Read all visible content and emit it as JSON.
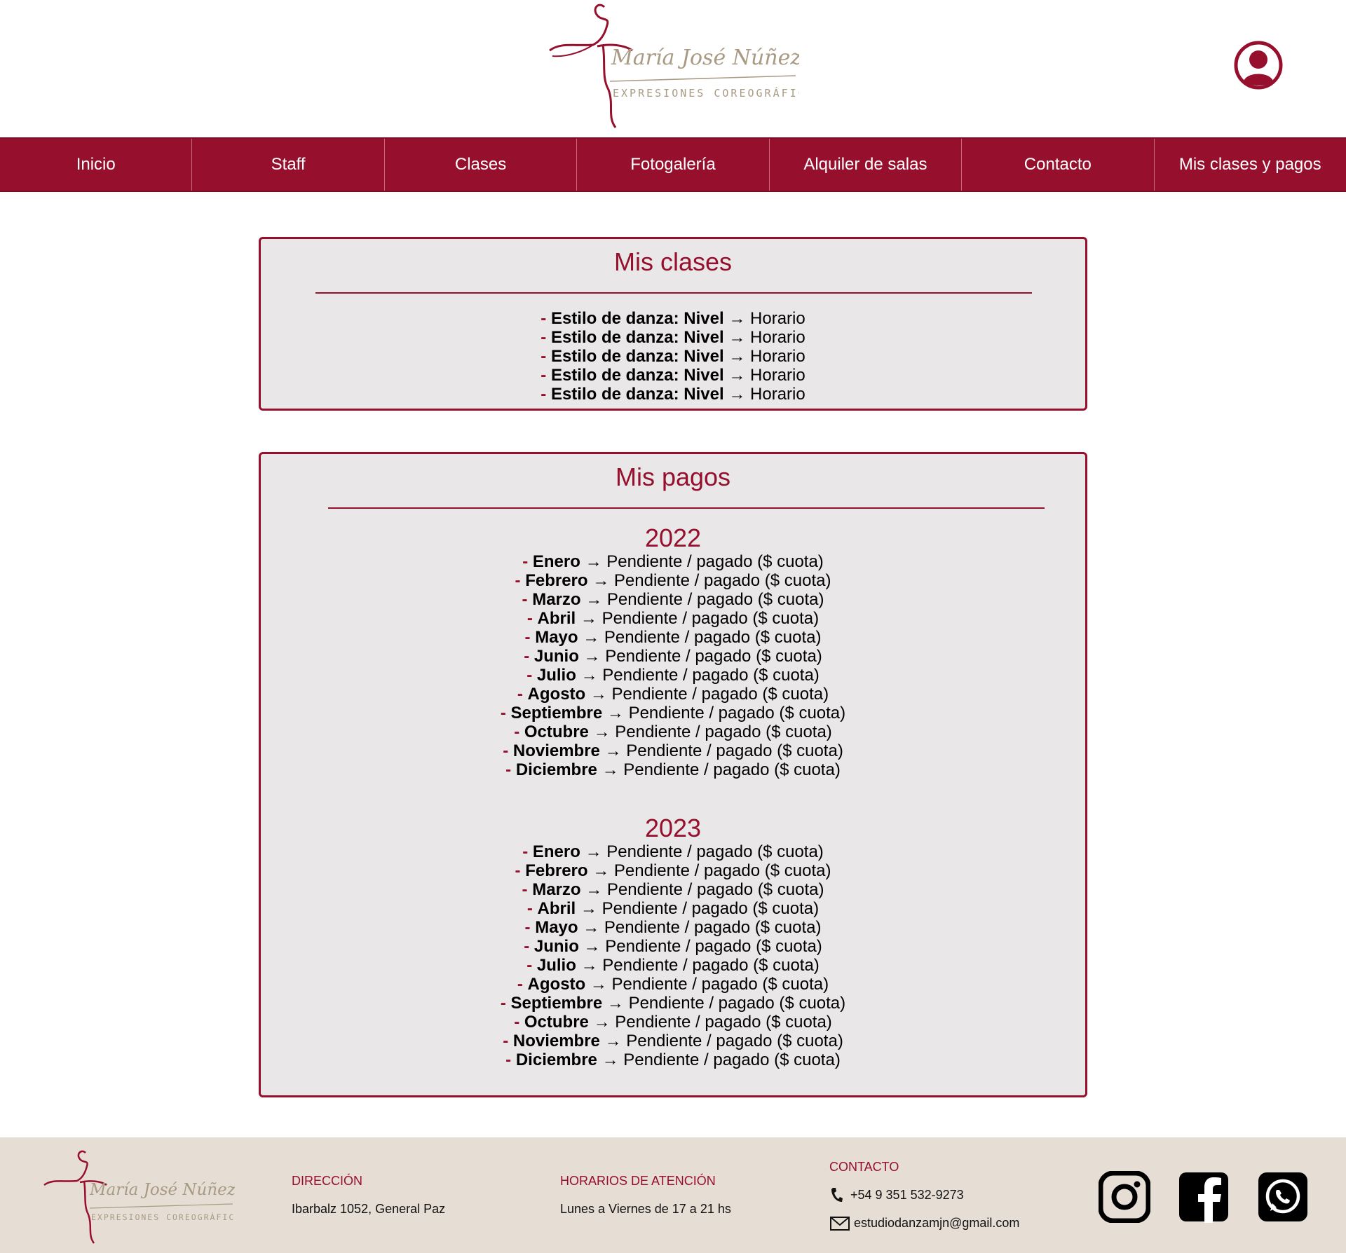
{
  "header": {
    "logo": {
      "name": "María José Núñez",
      "tagline": "EXPRESIONES COREOGRÁFICAS"
    },
    "account_icon": "user-circle-icon"
  },
  "nav": {
    "items": [
      "Inicio",
      "Staff",
      "Clases",
      "Fotogalería",
      "Alquiler de salas",
      "Contacto",
      "Mis clases y pagos"
    ]
  },
  "classes": {
    "title": "Mis clases",
    "items": [
      {
        "dash": "-",
        "label": "Estilo de danza: Nivel",
        "arrow": "→",
        "value": "Horario"
      },
      {
        "dash": "-",
        "label": "Estilo de danza: Nivel",
        "arrow": "→",
        "value": "Horario"
      },
      {
        "dash": "-",
        "label": "Estilo de danza: Nivel",
        "arrow": "→",
        "value": "Horario"
      },
      {
        "dash": "-",
        "label": "Estilo de danza: Nivel",
        "arrow": "→",
        "value": "Horario"
      },
      {
        "dash": "-",
        "label": "Estilo de danza: Nivel",
        "arrow": "→",
        "value": "Horario"
      }
    ]
  },
  "payments": {
    "title": "Mis pagos",
    "years": [
      {
        "year": "2022",
        "months": [
          {
            "dash": "-",
            "month": "Enero",
            "arrow": "→",
            "status": "Pendiente / pagado ($ cuota)"
          },
          {
            "dash": "-",
            "month": "Febrero",
            "arrow": "→",
            "status": "Pendiente / pagado ($ cuota)"
          },
          {
            "dash": "-",
            "month": "Marzo",
            "arrow": "→",
            "status": "Pendiente / pagado ($ cuota)"
          },
          {
            "dash": "-",
            "month": "Abril",
            "arrow": "→",
            "status": "Pendiente / pagado ($ cuota)"
          },
          {
            "dash": "-",
            "month": "Mayo",
            "arrow": "→",
            "status": "Pendiente / pagado ($ cuota)"
          },
          {
            "dash": "-",
            "month": "Junio",
            "arrow": "→",
            "status": "Pendiente / pagado ($ cuota)"
          },
          {
            "dash": "-",
            "month": "Julio",
            "arrow": "→",
            "status": "Pendiente / pagado ($ cuota)"
          },
          {
            "dash": "-",
            "month": "Agosto",
            "arrow": "→",
            "status": "Pendiente / pagado ($ cuota)"
          },
          {
            "dash": "-",
            "month": "Septiembre",
            "arrow": "→",
            "status": "Pendiente / pagado ($ cuota)"
          },
          {
            "dash": "-",
            "month": "Octubre",
            "arrow": "→",
            "status": "Pendiente / pagado ($ cuota)"
          },
          {
            "dash": "-",
            "month": "Noviembre",
            "arrow": "→",
            "status": "Pendiente / pagado ($ cuota)"
          },
          {
            "dash": "-",
            "month": "Diciembre",
            "arrow": "→",
            "status": "Pendiente / pagado ($ cuota)"
          }
        ]
      },
      {
        "year": "2023",
        "months": [
          {
            "dash": "-",
            "month": "Enero",
            "arrow": "→",
            "status": "Pendiente / pagado ($ cuota)"
          },
          {
            "dash": "-",
            "month": "Febrero",
            "arrow": "→",
            "status": "Pendiente / pagado ($ cuota)"
          },
          {
            "dash": "-",
            "month": "Marzo",
            "arrow": "→",
            "status": "Pendiente / pagado ($ cuota)"
          },
          {
            "dash": "-",
            "month": "Abril",
            "arrow": "→",
            "status": "Pendiente / pagado ($ cuota)"
          },
          {
            "dash": "-",
            "month": "Mayo",
            "arrow": "→",
            "status": "Pendiente / pagado ($ cuota)"
          },
          {
            "dash": "-",
            "month": "Junio",
            "arrow": "→",
            "status": "Pendiente / pagado ($ cuota)"
          },
          {
            "dash": "-",
            "month": "Julio",
            "arrow": "→",
            "status": "Pendiente / pagado ($ cuota)"
          },
          {
            "dash": "-",
            "month": "Agosto",
            "arrow": "→",
            "status": "Pendiente / pagado ($ cuota)"
          },
          {
            "dash": "-",
            "month": "Septiembre",
            "arrow": "→",
            "status": "Pendiente / pagado ($ cuota)"
          },
          {
            "dash": "-",
            "month": "Octubre",
            "arrow": "→",
            "status": "Pendiente / pagado ($ cuota)"
          },
          {
            "dash": "-",
            "month": "Noviembre",
            "arrow": "→",
            "status": "Pendiente / pagado ($ cuota)"
          },
          {
            "dash": "-",
            "month": "Diciembre",
            "arrow": "→",
            "status": "Pendiente / pagado ($ cuota)"
          }
        ]
      }
    ]
  },
  "footer": {
    "address": {
      "heading": "DIRECCIÓN",
      "text": "Ibarbalz 1052, General Paz"
    },
    "hours": {
      "heading": "HORARIOS DE ATENCIÓN",
      "text": "Lunes a Viernes de 17 a 21 hs"
    },
    "contact": {
      "heading": "CONTACTO",
      "phone": "+54 9 351 532-9273",
      "email": "estudiodanzamjn@gmail.com"
    },
    "social": [
      "instagram-icon",
      "facebook-icon",
      "whatsapp-icon"
    ]
  },
  "colors": {
    "brand": "#96102d",
    "panel_bg": "#e9e7e8",
    "footer_bg": "#e6ddd5",
    "logo_gold": "#a89a83"
  }
}
